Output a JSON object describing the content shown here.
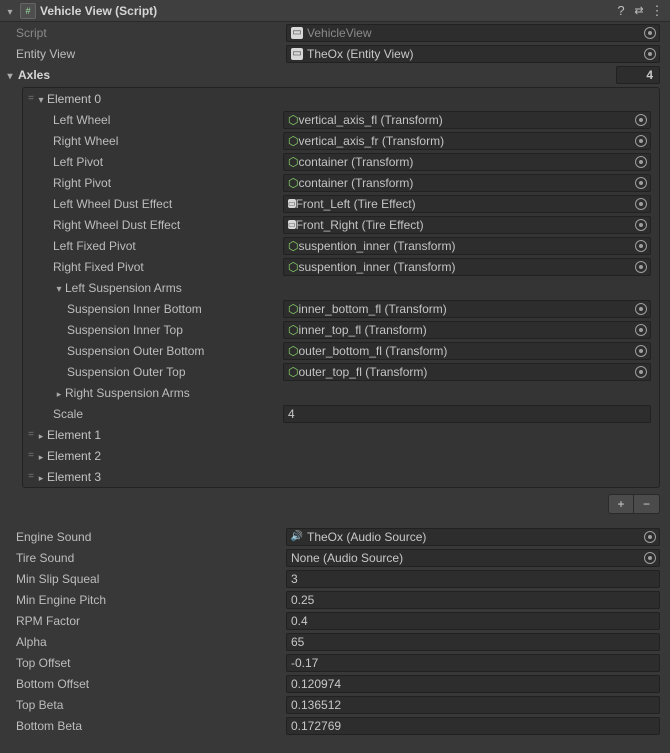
{
  "header": {
    "title": "Vehicle View (Script)"
  },
  "script": {
    "label": "Script",
    "value": "VehicleView"
  },
  "entityView": {
    "label": "Entity View",
    "value": "TheOx (Entity View)"
  },
  "axles": {
    "label": "Axles",
    "count": "4",
    "elements": [
      {
        "label": "Element 0",
        "expanded": true,
        "leftWheel": {
          "label": "Left Wheel",
          "value": "vertical_axis_fl (Transform)",
          "type": "transform"
        },
        "rightWheel": {
          "label": "Right Wheel",
          "value": "vertical_axis_fr (Transform)",
          "type": "transform"
        },
        "leftPivot": {
          "label": "Left Pivot",
          "value": "container (Transform)",
          "type": "transform"
        },
        "rightPivot": {
          "label": "Right Pivot",
          "value": "container (Transform)",
          "type": "transform"
        },
        "leftDust": {
          "label": "Left Wheel Dust Effect",
          "value": "Front_Left (Tire Effect)",
          "type": "script"
        },
        "rightDust": {
          "label": "Right Wheel Dust Effect",
          "value": "Front_Right (Tire Effect)",
          "type": "script"
        },
        "leftFixed": {
          "label": "Left Fixed Pivot",
          "value": "suspention_inner (Transform)",
          "type": "transform"
        },
        "rightFixed": {
          "label": "Right Fixed Pivot",
          "value": "suspention_inner (Transform)",
          "type": "transform"
        },
        "leftSusp": {
          "label": "Left Suspension Arms",
          "innerBottom": {
            "label": "Suspension Inner Bottom",
            "value": "inner_bottom_fl (Transform)"
          },
          "innerTop": {
            "label": "Suspension Inner Top",
            "value": "inner_top_fl (Transform)"
          },
          "outerBottom": {
            "label": "Suspension Outer Bottom",
            "value": "outer_bottom_fl (Transform)"
          },
          "outerTop": {
            "label": "Suspension Outer Top",
            "value": "outer_top_fl (Transform)"
          }
        },
        "rightSusp": {
          "label": "Right Suspension Arms"
        },
        "scale": {
          "label": "Scale",
          "value": "4"
        }
      },
      {
        "label": "Element 1"
      },
      {
        "label": "Element 2"
      },
      {
        "label": "Element 3"
      }
    ]
  },
  "engineSound": {
    "label": "Engine Sound",
    "value": "TheOx (Audio Source)"
  },
  "tireSound": {
    "label": "Tire Sound",
    "value": "None (Audio Source)"
  },
  "minSlip": {
    "label": "Min Slip Squeal",
    "value": "3"
  },
  "minEnginePitch": {
    "label": "Min Engine Pitch",
    "value": "0.25"
  },
  "rpmFactor": {
    "label": "RPM Factor",
    "value": "0.4"
  },
  "alpha": {
    "label": "Alpha",
    "value": "65"
  },
  "topOffset": {
    "label": "Top Offset",
    "value": "-0.17"
  },
  "bottomOffset": {
    "label": "Bottom Offset",
    "value": "0.120974"
  },
  "topBeta": {
    "label": "Top Beta",
    "value": "0.136512"
  },
  "bottomBeta": {
    "label": "Bottom Beta",
    "value": "0.172769"
  }
}
